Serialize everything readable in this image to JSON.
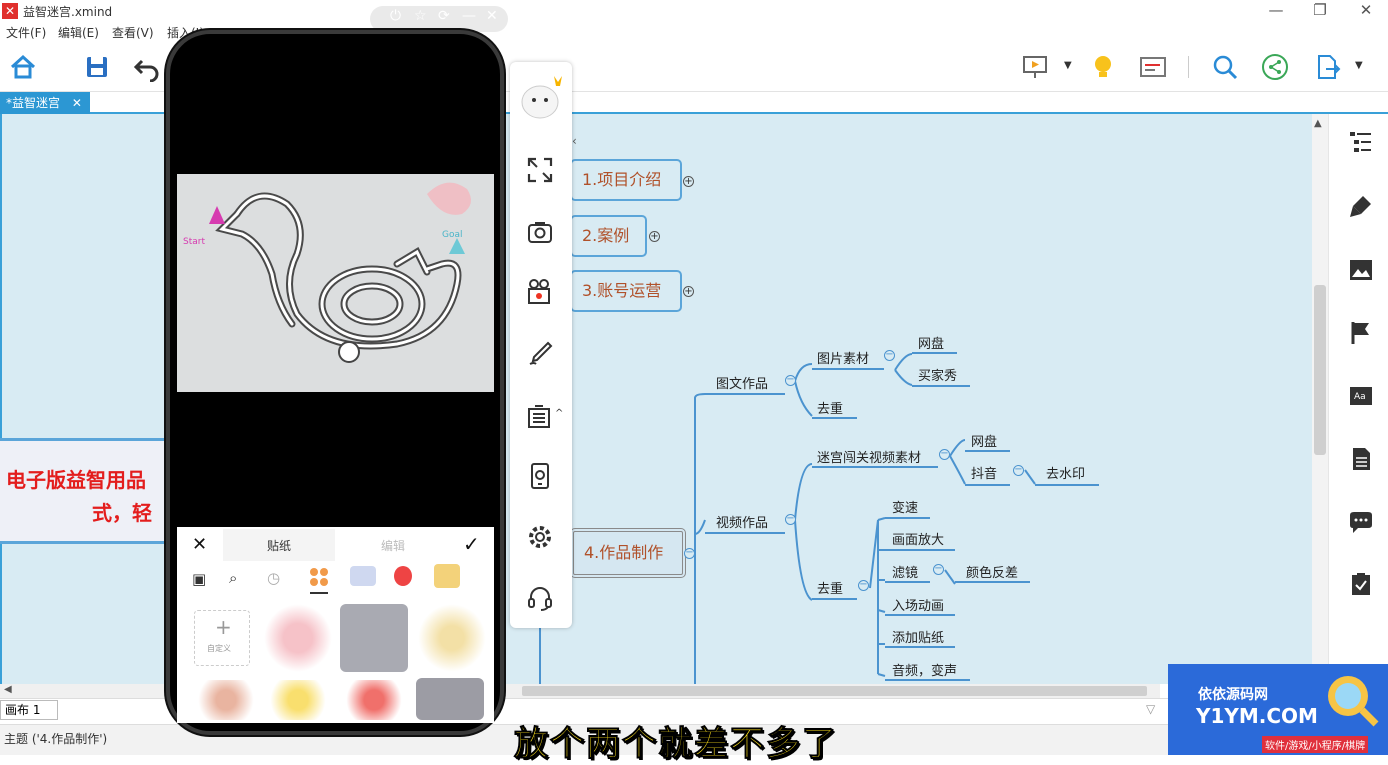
{
  "window": {
    "title": "益智迷宫.xmind"
  },
  "menu": [
    "文件(F)",
    "编辑(E)",
    "查看(V)",
    "插入(I)"
  ],
  "tab": {
    "label": "*益智迷宫",
    "close": "✕"
  },
  "mindmap": {
    "left_node_line1": "电子版益智用品",
    "left_node_line2": "式，轻",
    "topics": [
      "1.项目介绍",
      "2.案例",
      "3.账号运营",
      "4.作品制作"
    ],
    "branch_tuwen": "图文作品",
    "tupian_sucai": "图片素材",
    "wangpan1": "网盘",
    "maijiaxiu": "买家秀",
    "quchong1": "去重",
    "branch_shipin": "视频作品",
    "migong_sucai": "迷宫闯关视频素材",
    "wangpan2": "网盘",
    "douyin": "抖音",
    "qushuiyin": "去水印",
    "quchong2": "去重",
    "biansu": "变速",
    "huamian": "画面放大",
    "lvjing": "滤镜",
    "yanse": "颜色反差",
    "ruchang": "入场动画",
    "tiezhi": "添加贴纸",
    "yinpin": "音频，变声"
  },
  "phone": {
    "start_label": "Start",
    "goal_label": "Goal",
    "tab_sticker": "贴纸",
    "tab_edit": "编辑",
    "custom": "自定义",
    "close": "✕",
    "confirm": "✓"
  },
  "sheet": {
    "label": "画布 1"
  },
  "status": {
    "text": "主题 ('4.作品制作')"
  },
  "watermark": {
    "title": "依依源码网",
    "domain": "Y1YM.COM",
    "sub": "软件/游戏/小程序/棋牌"
  },
  "subtitle": "放个两个就差不多了"
}
